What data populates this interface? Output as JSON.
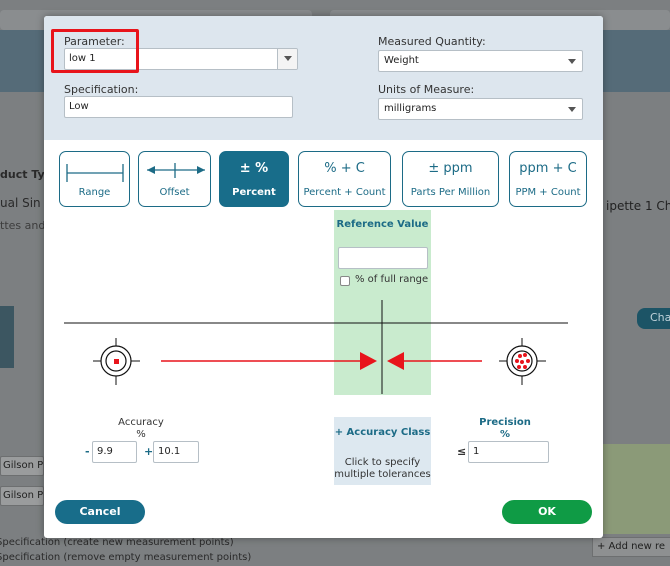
{
  "background": {
    "product_type_label": "duct Type",
    "manual_single_text": "ual Sin",
    "tes_text": "ttes and",
    "pipette_text": "ipette 1 Ch",
    "channel_button": "Cha",
    "gilson_row_1": "Gilson P",
    "gilson_row_2": "Gilson P",
    "spec_create": "Specification (create new measurement points)",
    "spec_remove": "Specification (remove empty measurement points)",
    "add_new": "+ Add new re"
  },
  "dialog": {
    "parameter_label": "Parameter:",
    "parameter_value": "low 1",
    "specification_label": "Specification:",
    "specification_value": "Low",
    "measured_quantity_label": "Measured Quantity:",
    "measured_quantity_value": "Weight",
    "units_label": "Units of Measure:",
    "units_value": "milligrams",
    "tolerance_types": [
      {
        "symbol": "",
        "caption": "Range",
        "icon": "range-icon"
      },
      {
        "symbol": "",
        "caption": "Offset",
        "icon": "offset-icon"
      },
      {
        "symbol": "± %",
        "caption": "Percent",
        "icon": ""
      },
      {
        "symbol": "% + C",
        "caption": "Percent + Count",
        "icon": ""
      },
      {
        "symbol": "± ppm",
        "caption": "Parts Per Million",
        "icon": ""
      },
      {
        "symbol": "ppm + C",
        "caption": "PPM + Count",
        "icon": ""
      }
    ],
    "selected_type": "Percent",
    "reference": {
      "title": "Reference Value",
      "value": "",
      "full_range_label": "% of full range"
    },
    "accuracy": {
      "title": "Accuracy",
      "unit": "%",
      "minus_sign": "-",
      "plus_sign": "+",
      "minus_value": "9.9",
      "plus_value": "10.1"
    },
    "accuracy_class": {
      "title": "+ Accuracy Class",
      "description": "Click to specify multiple tolerances"
    },
    "precision": {
      "title": "Precision",
      "unit": "%",
      "le_sign": "≤",
      "value": "1"
    },
    "cancel_label": "Cancel",
    "ok_label": "OK"
  },
  "colors": {
    "accent": "#186d8a",
    "ok_green": "#0f9b45",
    "highlight_red": "#e8141b",
    "target_red": "#e8141b",
    "reference_green": "#c9ebce"
  }
}
